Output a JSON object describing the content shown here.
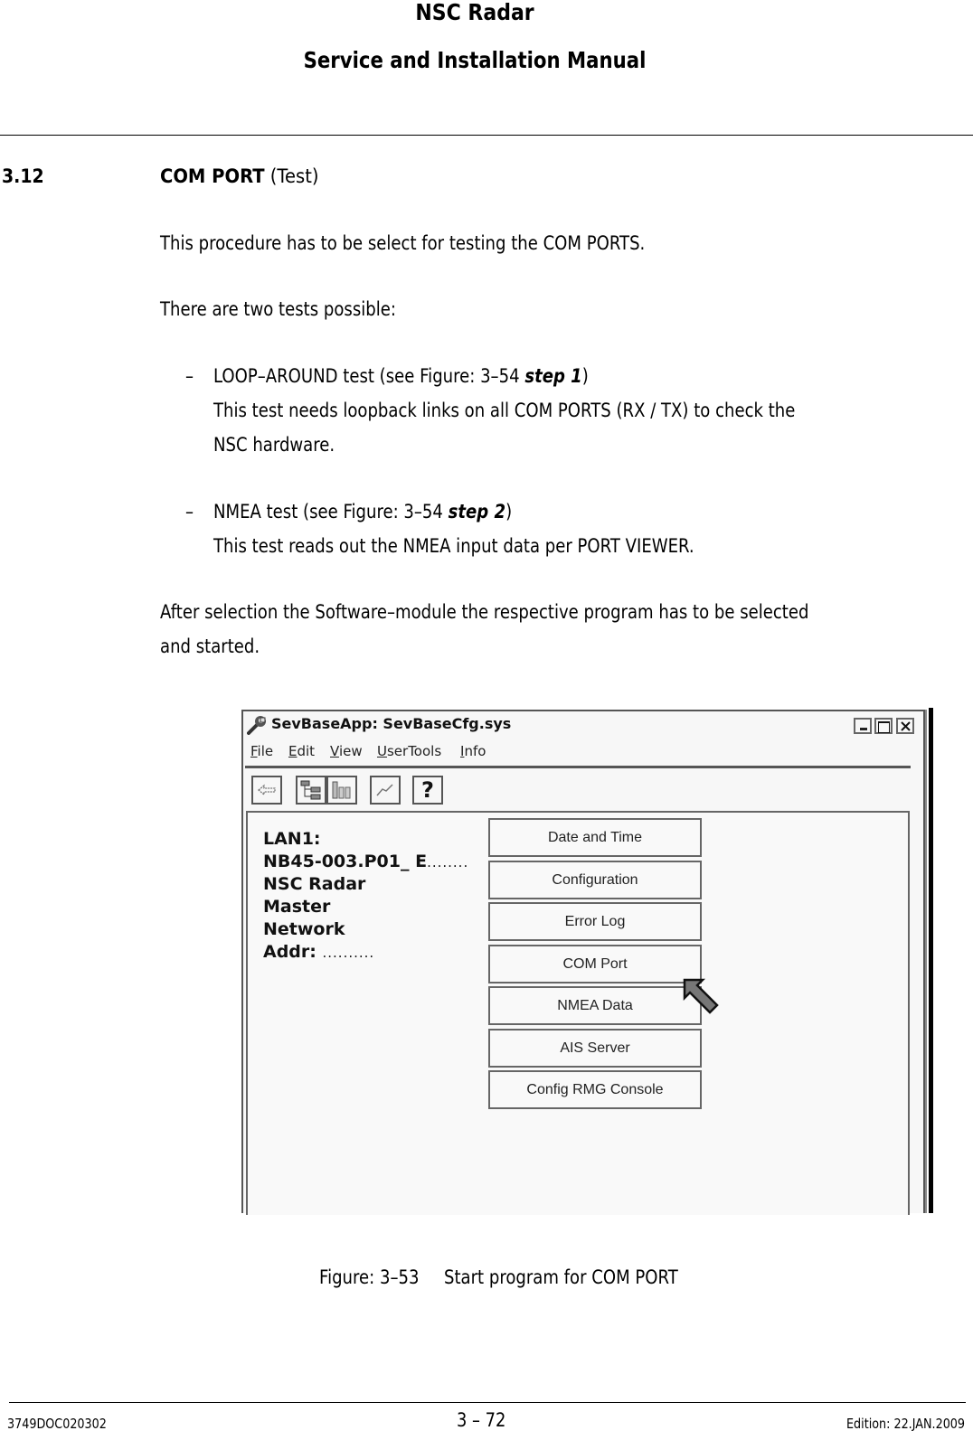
{
  "header": {
    "title": "NSC Radar",
    "subtitle": "Service and Installation Manual"
  },
  "section": {
    "number": "3.12",
    "title_bold": "COM PORT",
    "title_rest": " (Test)"
  },
  "paragraphs": {
    "intro": "This procedure has to be select for testing the COM PORTS.",
    "tests_intro": "There are two tests possible:",
    "after": "After selection the Software–module the respective program has to be selected",
    "after_cont": "and started."
  },
  "tests": [
    {
      "bullet": "–",
      "head": "LOOP–AROUND test (see Figure: 3–54 ",
      "step": "step 1",
      "close": ")",
      "desc1": "This test needs loopback links on all COM PORTS (RX / TX) to check the",
      "desc2": "NSC hardware."
    },
    {
      "bullet": "–",
      "head": "NMEA test (see Figure: 3–54 ",
      "step": "step 2",
      "close": ")",
      "desc1": "This test reads out the NMEA input data per PORT VIEWER."
    }
  ],
  "figure": {
    "window_title": "SevBaseApp:  SevBaseCfg.sys",
    "menu": [
      {
        "mnemonic": "F",
        "rest": "ile"
      },
      {
        "mnemonic": "E",
        "rest": "dit"
      },
      {
        "mnemonic": "V",
        "rest": "iew"
      },
      {
        "mnemonic": "U",
        "rest": "serTools"
      },
      {
        "mnemonic": "I",
        "rest": "nfo"
      }
    ],
    "toolbar_icons": [
      "back-arrow-icon",
      "tree-view-icon",
      "module-list-icon",
      "chart-line-icon",
      "help-icon"
    ],
    "help_glyph": "?",
    "info": {
      "line1": "LAN1:",
      "line2": "NB45-003.P01_ E",
      "line2_dots": "........",
      "line3": "NSC Radar",
      "line4": "Master",
      "line5": "Network",
      "line6": "Addr:",
      "line6_dots": ".........."
    },
    "buttons": [
      "Date and Time",
      "Configuration",
      "Error Log",
      "COM Port",
      "NMEA Data",
      "AIS Server",
      "Config RMG Console"
    ],
    "pointed_button": "COM Port",
    "caption_label": "Figure: 3–53",
    "caption_text": "Start program for COM PORT"
  },
  "footer": {
    "doc_id": "3749DOC020302",
    "page": "3 – 72",
    "edition": "Edition: 22.JAN.2009"
  }
}
